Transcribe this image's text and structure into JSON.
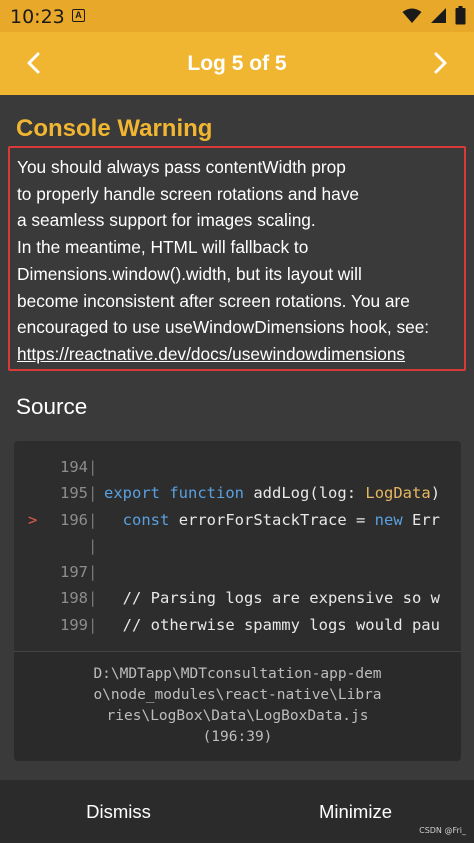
{
  "status_bar": {
    "time": "10:23",
    "notification_icon": "A",
    "icons": [
      "wifi-icon",
      "signal-icon",
      "battery-icon"
    ]
  },
  "header": {
    "title": "Log 5 of 5",
    "prev_icon": "chevron-left-icon",
    "next_icon": "chevron-right-icon"
  },
  "warning": {
    "title": "Console Warning",
    "message": "You should always pass contentWidth prop\nto properly handle screen rotations and have\na seamless support for images scaling.\nIn the meantime, HTML will fallback to\nDimensions.window().width, but its layout will\nbecome inconsistent after screen rotations. You are\nencouraged to use useWindowDimensions hook, see:",
    "link": "https://reactnative.dev/docs/usewindowdimensions"
  },
  "source": {
    "title": "Source",
    "lines": [
      {
        "marker": "",
        "num": "194",
        "gutter": "|",
        "code": ""
      },
      {
        "marker": "",
        "num": "195",
        "gutter": "|",
        "code": "export function addLog(log: LogData)"
      },
      {
        "marker": ">",
        "num": "196",
        "gutter": "|",
        "code": "  const errorForStackTrace = new Err"
      },
      {
        "marker": "",
        "num": "",
        "gutter": "|",
        "code": ""
      },
      {
        "marker": "",
        "num": "197",
        "gutter": "|",
        "code": ""
      },
      {
        "marker": "",
        "num": "198",
        "gutter": "|",
        "code": "  // Parsing logs are expensive so w"
      },
      {
        "marker": "",
        "num": "199",
        "gutter": "|",
        "code": "  // otherwise spammy logs would pau"
      }
    ],
    "file_path": "D:\\MDTapp\\MDTconsultation-app-dem\no\\node_modules\\react-native\\Libra\nries\\LogBox\\Data\\LogBoxData.js\n(196:39)"
  },
  "footer": {
    "dismiss_label": "Dismiss",
    "minimize_label": "Minimize"
  },
  "watermark": "CSDN @Fri_",
  "colors": {
    "accent": "#f1b631",
    "status_bar": "#e8a92a",
    "error_border": "#d83a3a",
    "background": "#3a3a3a",
    "code_background": "#2d2d2d",
    "keyword": "#5aa0e0",
    "type": "#e5b760"
  }
}
